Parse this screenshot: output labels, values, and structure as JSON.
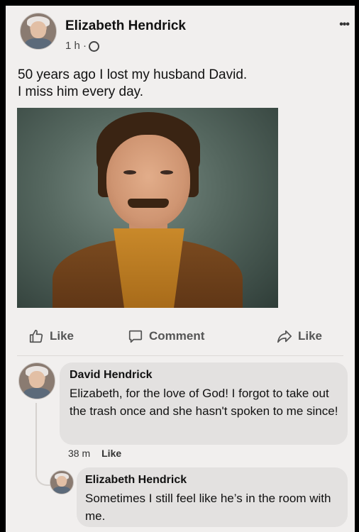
{
  "post": {
    "author": "Elizabeth Hendrick",
    "time": "1 h ·",
    "more_icon": "•••",
    "text_line1": "50 years ago I lost my husband David.",
    "text_line2": "I miss him every day."
  },
  "actions": {
    "like": "Like",
    "comment": "Comment",
    "share": "Like"
  },
  "comments": [
    {
      "author": "David Hendrick",
      "text": "Elizabeth, for the love of God! I forgot to take out the trash once and she hasn't spoken to me since!",
      "time": "38 m",
      "like": "Like"
    },
    {
      "author": "Elizabeth Hendrick",
      "text": "Sometimes I still feel like he’s in the room with me."
    }
  ]
}
